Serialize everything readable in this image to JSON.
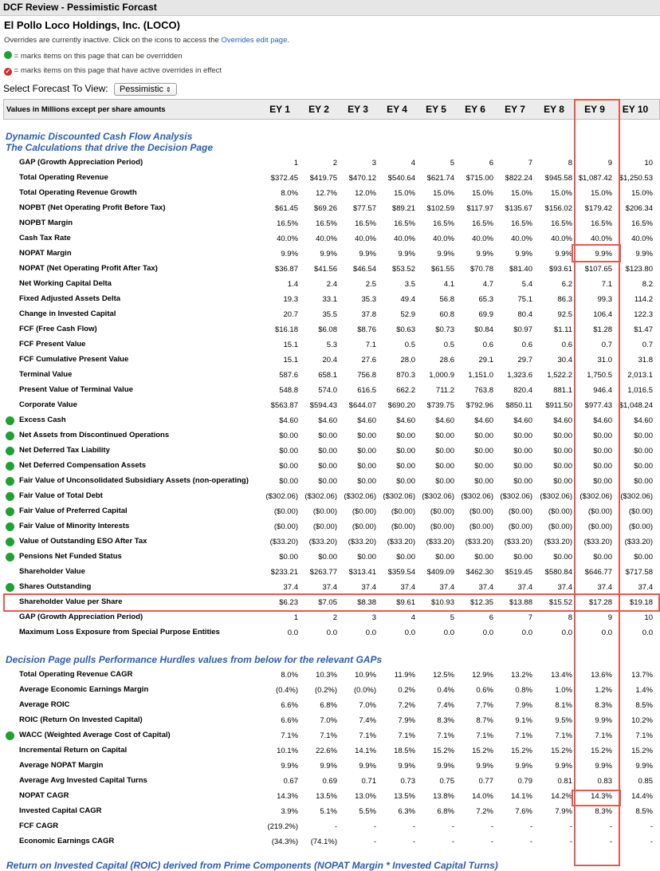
{
  "window": {
    "title": "DCF Review - Pessimistic Forcast"
  },
  "company": "El Pollo Loco Holdings, Inc. (LOCO)",
  "overrides_note": {
    "text": "Overrides are currently inactive. Click on the icons to access the ",
    "link": "Overrides edit page",
    "end": "."
  },
  "legend": {
    "green": "= marks items on this page that can be overridden",
    "red": "= marks items on this page that have active overrides in effect"
  },
  "selector": {
    "label": "Select Forecast To View:",
    "value": "Pessimistic"
  },
  "header": {
    "label": "Values in Millions except per share amounts",
    "columns": [
      "EY 1",
      "EY 2",
      "EY 3",
      "EY 4",
      "EY 5",
      "EY 6",
      "EY 7",
      "EY 8",
      "EY 9",
      "EY 10"
    ]
  },
  "section1": {
    "line1": "Dynamic Discounted Cash Flow Analysis",
    "line2": "The Calculations that drive the Decision Page"
  },
  "section2": {
    "line1": "Decision Page pulls Performance Hurdles values from below for the relevant GAPs"
  },
  "section3": {
    "line1": "Return on Invested Capital (ROIC) derived from Prime Components (NOPAT Margin * Invested Capital Turns)"
  },
  "rows1": [
    {
      "label": "GAP (Growth Appreciation Period)",
      "dot": false,
      "v": [
        "1",
        "2",
        "3",
        "4",
        "5",
        "6",
        "7",
        "8",
        "9",
        "10"
      ]
    },
    {
      "label": "Total Operating Revenue",
      "dot": false,
      "v": [
        "$372.45",
        "$419.75",
        "$470.12",
        "$540.64",
        "$621.74",
        "$715.00",
        "$822.24",
        "$945.58",
        "$1,087.42",
        "$1,250.53"
      ]
    },
    {
      "label": "Total Operating Revenue Growth",
      "dot": false,
      "v": [
        "8.0%",
        "12.7%",
        "12.0%",
        "15.0%",
        "15.0%",
        "15.0%",
        "15.0%",
        "15.0%",
        "15.0%",
        "15.0%"
      ]
    },
    {
      "label": "NOPBT (Net Operating Profit Before Tax)",
      "dot": false,
      "v": [
        "$61.45",
        "$69.26",
        "$77.57",
        "$89.21",
        "$102.59",
        "$117.97",
        "$135.67",
        "$156.02",
        "$179.42",
        "$206.34"
      ]
    },
    {
      "label": "NOPBT Margin",
      "dot": false,
      "v": [
        "16.5%",
        "16.5%",
        "16.5%",
        "16.5%",
        "16.5%",
        "16.5%",
        "16.5%",
        "16.5%",
        "16.5%",
        "16.5%"
      ]
    },
    {
      "label": "Cash Tax Rate",
      "dot": false,
      "v": [
        "40.0%",
        "40.0%",
        "40.0%",
        "40.0%",
        "40.0%",
        "40.0%",
        "40.0%",
        "40.0%",
        "40.0%",
        "40.0%"
      ]
    },
    {
      "label": "NOPAT Margin",
      "dot": false,
      "v": [
        "9.9%",
        "9.9%",
        "9.9%",
        "9.9%",
        "9.9%",
        "9.9%",
        "9.9%",
        "9.9%",
        "9.9%",
        "9.9%"
      ]
    },
    {
      "label": "NOPAT (Net Operating Profit After Tax)",
      "dot": false,
      "v": [
        "$36.87",
        "$41.56",
        "$46.54",
        "$53.52",
        "$61.55",
        "$70.78",
        "$81.40",
        "$93.61",
        "$107.65",
        "$123.80"
      ]
    },
    {
      "label": "Net Working Capital Delta",
      "dot": false,
      "v": [
        "1.4",
        "2.4",
        "2.5",
        "3.5",
        "4.1",
        "4.7",
        "5.4",
        "6.2",
        "7.1",
        "8.2"
      ]
    },
    {
      "label": "Fixed Adjusted Assets Delta",
      "dot": false,
      "v": [
        "19.3",
        "33.1",
        "35.3",
        "49.4",
        "56.8",
        "65.3",
        "75.1",
        "86.3",
        "99.3",
        "114.2"
      ]
    },
    {
      "label": "Change in Invested Capital",
      "dot": false,
      "v": [
        "20.7",
        "35.5",
        "37.8",
        "52.9",
        "60.8",
        "69.9",
        "80.4",
        "92.5",
        "106.4",
        "122.3"
      ]
    },
    {
      "label": "FCF (Free Cash Flow)",
      "dot": false,
      "v": [
        "$16.18",
        "$6.08",
        "$8.76",
        "$0.63",
        "$0.73",
        "$0.84",
        "$0.97",
        "$1.11",
        "$1.28",
        "$1.47"
      ]
    },
    {
      "label": "FCF Present Value",
      "dot": false,
      "v": [
        "15.1",
        "5.3",
        "7.1",
        "0.5",
        "0.5",
        "0.6",
        "0.6",
        "0.6",
        "0.7",
        "0.7"
      ]
    },
    {
      "label": "FCF Cumulative Present Value",
      "dot": false,
      "v": [
        "15.1",
        "20.4",
        "27.6",
        "28.0",
        "28.6",
        "29.1",
        "29.7",
        "30.4",
        "31.0",
        "31.8"
      ]
    },
    {
      "label": "Terminal Value",
      "dot": false,
      "v": [
        "587.6",
        "658.1",
        "756.8",
        "870.3",
        "1,000.9",
        "1,151.0",
        "1,323.6",
        "1,522.2",
        "1,750.5",
        "2,013.1"
      ]
    },
    {
      "label": "Present Value of Terminal Value",
      "dot": false,
      "v": [
        "548.8",
        "574.0",
        "616.5",
        "662.2",
        "711.2",
        "763.8",
        "820.4",
        "881.1",
        "946.4",
        "1,016.5"
      ]
    },
    {
      "label": "Corporate Value",
      "dot": false,
      "v": [
        "$563.87",
        "$594.43",
        "$644.07",
        "$690.20",
        "$739.75",
        "$792.96",
        "$850.11",
        "$911.50",
        "$977.43",
        "$1,048.24"
      ]
    },
    {
      "label": "Excess Cash",
      "dot": true,
      "v": [
        "$4.60",
        "$4.60",
        "$4.60",
        "$4.60",
        "$4.60",
        "$4.60",
        "$4.60",
        "$4.60",
        "$4.60",
        "$4.60"
      ]
    },
    {
      "label": "Net Assets from Discontinued Operations",
      "dot": true,
      "v": [
        "$0.00",
        "$0.00",
        "$0.00",
        "$0.00",
        "$0.00",
        "$0.00",
        "$0.00",
        "$0.00",
        "$0.00",
        "$0.00"
      ]
    },
    {
      "label": "Net Deferred Tax Liability",
      "dot": true,
      "v": [
        "$0.00",
        "$0.00",
        "$0.00",
        "$0.00",
        "$0.00",
        "$0.00",
        "$0.00",
        "$0.00",
        "$0.00",
        "$0.00"
      ]
    },
    {
      "label": "Net Deferred Compensation Assets",
      "dot": true,
      "v": [
        "$0.00",
        "$0.00",
        "$0.00",
        "$0.00",
        "$0.00",
        "$0.00",
        "$0.00",
        "$0.00",
        "$0.00",
        "$0.00"
      ]
    },
    {
      "label": "Fair Value of Unconsolidated Subsidiary Assets (non-operating)",
      "dot": true,
      "v": [
        "$0.00",
        "$0.00",
        "$0.00",
        "$0.00",
        "$0.00",
        "$0.00",
        "$0.00",
        "$0.00",
        "$0.00",
        "$0.00"
      ]
    },
    {
      "label": "Fair Value of Total Debt",
      "dot": true,
      "v": [
        "($302.06)",
        "($302.06)",
        "($302.06)",
        "($302.06)",
        "($302.06)",
        "($302.06)",
        "($302.06)",
        "($302.06)",
        "($302.06)",
        "($302.06)"
      ]
    },
    {
      "label": "Fair Value of Preferred Capital",
      "dot": true,
      "v": [
        "($0.00)",
        "($0.00)",
        "($0.00)",
        "($0.00)",
        "($0.00)",
        "($0.00)",
        "($0.00)",
        "($0.00)",
        "($0.00)",
        "($0.00)"
      ]
    },
    {
      "label": "Fair Value of Minority Interests",
      "dot": true,
      "v": [
        "($0.00)",
        "($0.00)",
        "($0.00)",
        "($0.00)",
        "($0.00)",
        "($0.00)",
        "($0.00)",
        "($0.00)",
        "($0.00)",
        "($0.00)"
      ]
    },
    {
      "label": "Value of Outstanding ESO After Tax",
      "dot": true,
      "v": [
        "($33.20)",
        "($33.20)",
        "($33.20)",
        "($33.20)",
        "($33.20)",
        "($33.20)",
        "($33.20)",
        "($33.20)",
        "($33.20)",
        "($33.20)"
      ]
    },
    {
      "label": "Pensions Net Funded Status",
      "dot": true,
      "v": [
        "$0.00",
        "$0.00",
        "$0.00",
        "$0.00",
        "$0.00",
        "$0.00",
        "$0.00",
        "$0.00",
        "$0.00",
        "$0.00"
      ]
    },
    {
      "label": "Shareholder Value",
      "dot": false,
      "v": [
        "$233.21",
        "$263.77",
        "$313.41",
        "$359.54",
        "$409.09",
        "$462.30",
        "$519.45",
        "$580.84",
        "$646.77",
        "$717.58"
      ]
    },
    {
      "label": "Shares Outstanding",
      "dot": true,
      "v": [
        "37.4",
        "37.4",
        "37.4",
        "37.4",
        "37.4",
        "37.4",
        "37.4",
        "37.4",
        "37.4",
        "37.4"
      ]
    },
    {
      "label": "Shareholder Value per Share",
      "dot": false,
      "v": [
        "$6.23",
        "$7.05",
        "$8.38",
        "$9.61",
        "$10.93",
        "$12.35",
        "$13.88",
        "$15.52",
        "$17.28",
        "$19.18"
      ]
    },
    {
      "label": "GAP (Growth Appreciation Period)",
      "dot": false,
      "v": [
        "1",
        "2",
        "3",
        "4",
        "5",
        "6",
        "7",
        "8",
        "9",
        "10"
      ]
    },
    {
      "label": "Maximum Loss Exposure from Special Purpose Entities",
      "dot": false,
      "v": [
        "0.0",
        "0.0",
        "0.0",
        "0.0",
        "0.0",
        "0.0",
        "0.0",
        "0.0",
        "0.0",
        "0.0"
      ]
    }
  ],
  "rows2": [
    {
      "label": "Total Operating Revenue CAGR",
      "dot": false,
      "v": [
        "8.0%",
        "10.3%",
        "10.9%",
        "11.9%",
        "12.5%",
        "12.9%",
        "13.2%",
        "13.4%",
        "13.6%",
        "13.7%"
      ]
    },
    {
      "label": "Average Economic Earnings Margin",
      "dot": false,
      "v": [
        "(0.4%)",
        "(0.2%)",
        "(0.0%)",
        "0.2%",
        "0.4%",
        "0.6%",
        "0.8%",
        "1.0%",
        "1.2%",
        "1.4%"
      ]
    },
    {
      "label": "Average ROIC",
      "dot": false,
      "v": [
        "6.6%",
        "6.8%",
        "7.0%",
        "7.2%",
        "7.4%",
        "7.7%",
        "7.9%",
        "8.1%",
        "8.3%",
        "8.5%"
      ]
    },
    {
      "label": "ROIC (Return On Invested Capital)",
      "dot": false,
      "v": [
        "6.6%",
        "7.0%",
        "7.4%",
        "7.9%",
        "8.3%",
        "8.7%",
        "9.1%",
        "9.5%",
        "9.9%",
        "10.2%"
      ]
    },
    {
      "label": "WACC (Weighted Average Cost of Capital)",
      "dot": true,
      "v": [
        "7.1%",
        "7.1%",
        "7.1%",
        "7.1%",
        "7.1%",
        "7.1%",
        "7.1%",
        "7.1%",
        "7.1%",
        "7.1%"
      ]
    },
    {
      "label": "Incremental Return on Capital",
      "dot": false,
      "v": [
        "10.1%",
        "22.6%",
        "14.1%",
        "18.5%",
        "15.2%",
        "15.2%",
        "15.2%",
        "15.2%",
        "15.2%",
        "15.2%"
      ]
    },
    {
      "label": "Average NOPAT Margin",
      "dot": false,
      "v": [
        "9.9%",
        "9.9%",
        "9.9%",
        "9.9%",
        "9.9%",
        "9.9%",
        "9.9%",
        "9.9%",
        "9.9%",
        "9.9%"
      ]
    },
    {
      "label": "Average Avg Invested Capital Turns",
      "dot": false,
      "v": [
        "0.67",
        "0.69",
        "0.71",
        "0.73",
        "0.75",
        "0.77",
        "0.79",
        "0.81",
        "0.83",
        "0.85"
      ]
    },
    {
      "label": "NOPAT CAGR",
      "dot": false,
      "v": [
        "14.3%",
        "13.5%",
        "13.0%",
        "13.5%",
        "13.8%",
        "14.0%",
        "14.1%",
        "14.2%",
        "14.3%",
        "14.4%"
      ]
    },
    {
      "label": "Invested Capital CAGR",
      "dot": false,
      "v": [
        "3.9%",
        "5.1%",
        "5.5%",
        "6.3%",
        "6.8%",
        "7.2%",
        "7.6%",
        "7.9%",
        "8.3%",
        "8.5%"
      ]
    },
    {
      "label": "FCF CAGR",
      "dot": false,
      "v": [
        "(219.2%)",
        "-",
        "-",
        "-",
        "-",
        "-",
        "-",
        "-",
        "-",
        "-"
      ]
    },
    {
      "label": "Economic Earnings CAGR",
      "dot": false,
      "v": [
        "(34.3%)",
        "(74.1%)",
        "-",
        "-",
        "-",
        "-",
        "-",
        "-",
        "-",
        "-"
      ]
    }
  ],
  "colors": {
    "accent_blue": "#2a5db0",
    "green_dot": "#1ea131",
    "highlight_red": "#e55a50"
  }
}
